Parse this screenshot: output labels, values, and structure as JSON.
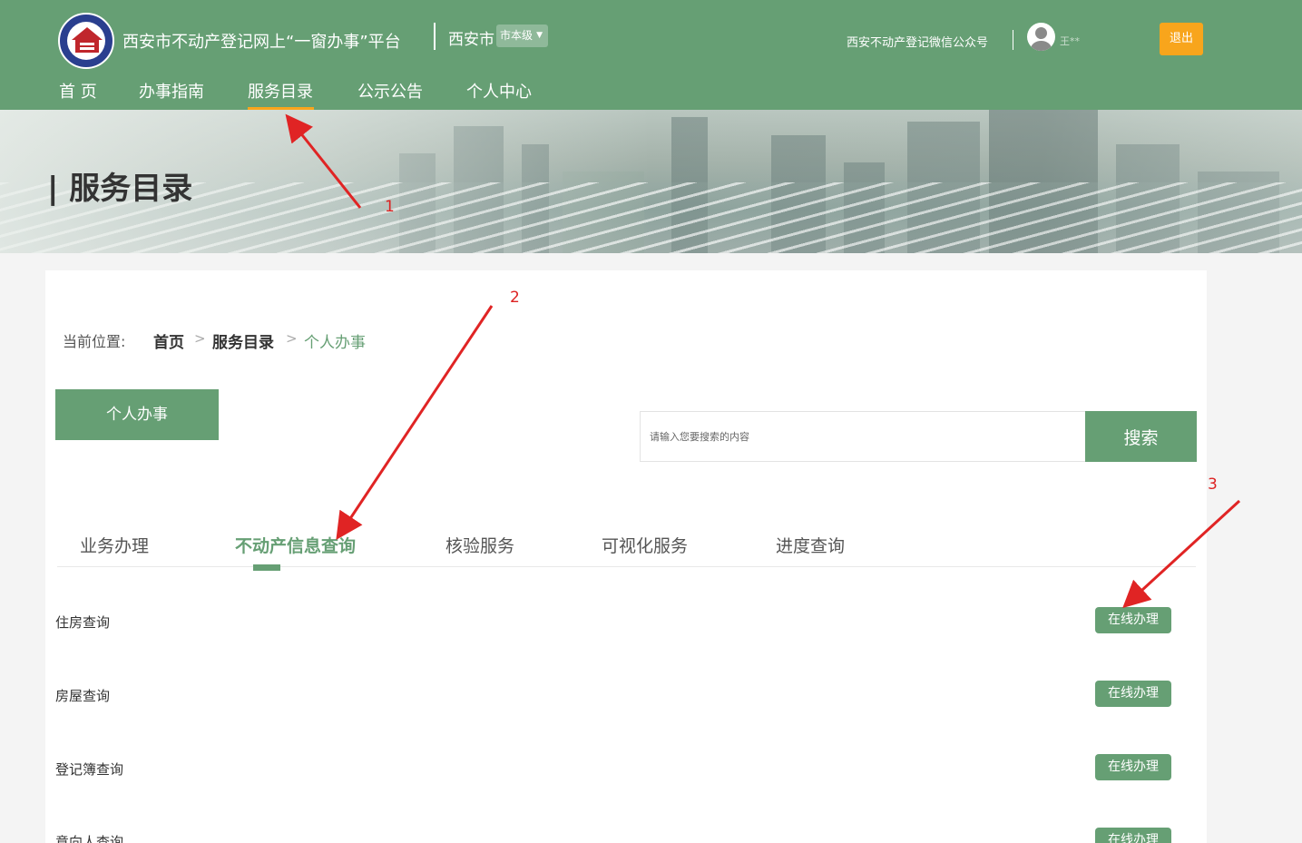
{
  "header": {
    "site_title": "西安市不动产登记网上“一窗办事”平台",
    "city": "西安市",
    "level": "市本级",
    "wechat": "西安不动产登记微信公众号",
    "username": "王**",
    "logout_label": "退出"
  },
  "nav": [
    {
      "label": "首 页"
    },
    {
      "label": "办事指南"
    },
    {
      "label": "服务目录"
    },
    {
      "label": "公示公告"
    },
    {
      "label": "个人中心"
    }
  ],
  "banner": {
    "title": "| 服务目录"
  },
  "breadcrumb": {
    "label": "当前位置:",
    "home": "首页",
    "sep": ">",
    "catalog": "服务目录",
    "current": "个人办事"
  },
  "personal_button": "个人办事",
  "search": {
    "placeholder": "请输入您要搜索的内容",
    "button": "搜索"
  },
  "tabs": [
    {
      "label": "业务办理"
    },
    {
      "label": "不动产信息查询"
    },
    {
      "label": "核验服务"
    },
    {
      "label": "可视化服务"
    },
    {
      "label": "进度查询"
    }
  ],
  "services": [
    {
      "name": "住房查询",
      "action": "在线办理"
    },
    {
      "name": "房屋查询",
      "action": "在线办理"
    },
    {
      "name": "登记簿查询",
      "action": "在线办理"
    },
    {
      "name": "意向人查询",
      "action": "在线办理"
    }
  ],
  "annotations": [
    "1",
    "2",
    "3"
  ],
  "colors": {
    "primary": "#669f74",
    "accent": "#f8a51c",
    "annotation": "#dd2222"
  }
}
